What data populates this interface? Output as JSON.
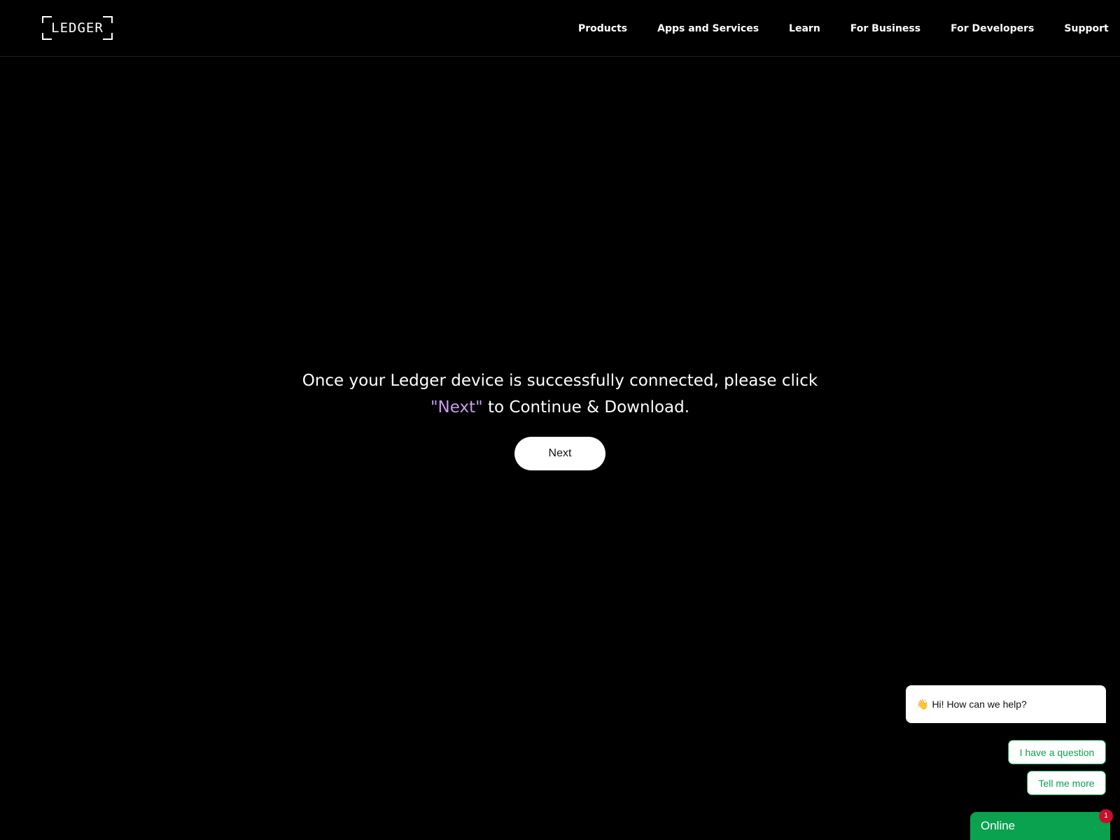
{
  "header": {
    "logo_text": "LEDGER",
    "nav": [
      {
        "label": "Products"
      },
      {
        "label": "Apps and Services"
      },
      {
        "label": "Learn"
      },
      {
        "label": "For Business"
      },
      {
        "label": "For Developers"
      },
      {
        "label": "Support"
      }
    ]
  },
  "main": {
    "message_part1": "Once your Ledger device is successfully connected, please click ",
    "message_highlight": "\"Next\"",
    "message_part2": " to Continue & Download.",
    "next_button_label": "Next"
  },
  "chat": {
    "greeting_icon": "👋",
    "greeting": "Hi! How can we help?",
    "options": [
      {
        "label": "I have a question"
      },
      {
        "label": "Tell me more"
      }
    ],
    "status_label": "Online",
    "unread_count": "1"
  },
  "colors": {
    "background": "#000000",
    "highlight": "#c99cf0",
    "chat_green": "#0aa14f",
    "badge_red": "#c8102e"
  }
}
